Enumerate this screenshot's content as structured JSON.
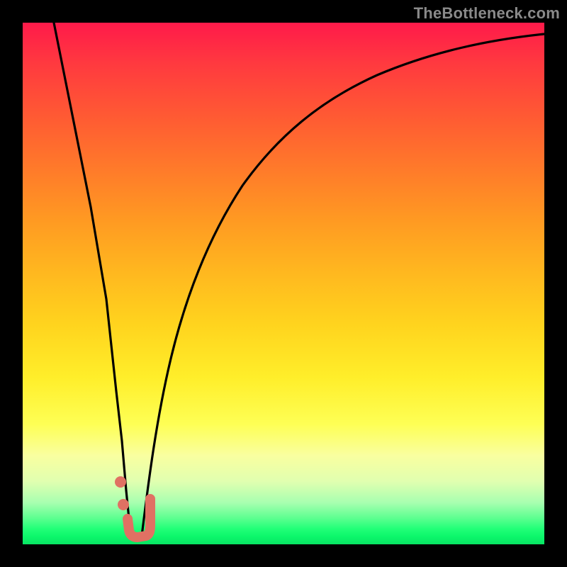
{
  "watermark": "TheBottleneck.com",
  "colors": {
    "marker": "#e07163",
    "curve": "#000000",
    "frame": "#000000"
  },
  "chart_data": {
    "type": "line",
    "title": "",
    "xlabel": "",
    "ylabel": "",
    "xlim": [
      0,
      100
    ],
    "ylim": [
      0,
      100
    ],
    "grid": false,
    "legend": false,
    "series": [
      {
        "name": "left-branch",
        "x": [
          6,
          8,
          10,
          12,
          14,
          15,
          16,
          17,
          18
        ],
        "values": [
          100,
          82,
          64,
          46,
          28,
          19,
          10,
          5,
          2
        ]
      },
      {
        "name": "right-branch",
        "x": [
          20,
          22,
          24,
          26,
          28,
          30,
          34,
          38,
          44,
          52,
          62,
          74,
          88,
          100
        ],
        "values": [
          2,
          10,
          22,
          34,
          45,
          54,
          66,
          74,
          81,
          87,
          91,
          94,
          96,
          97
        ]
      }
    ],
    "markers": [
      {
        "name": "dot-upper",
        "x": 16.5,
        "y": 12
      },
      {
        "name": "dot-lower",
        "x": 17,
        "y": 7
      },
      {
        "name": "hook",
        "points_x": [
          18,
          18.2,
          18.6,
          19.4,
          20.4,
          21,
          21.2
        ],
        "points_y": [
          3,
          2,
          1.4,
          1.2,
          1.6,
          4,
          8
        ]
      }
    ]
  }
}
